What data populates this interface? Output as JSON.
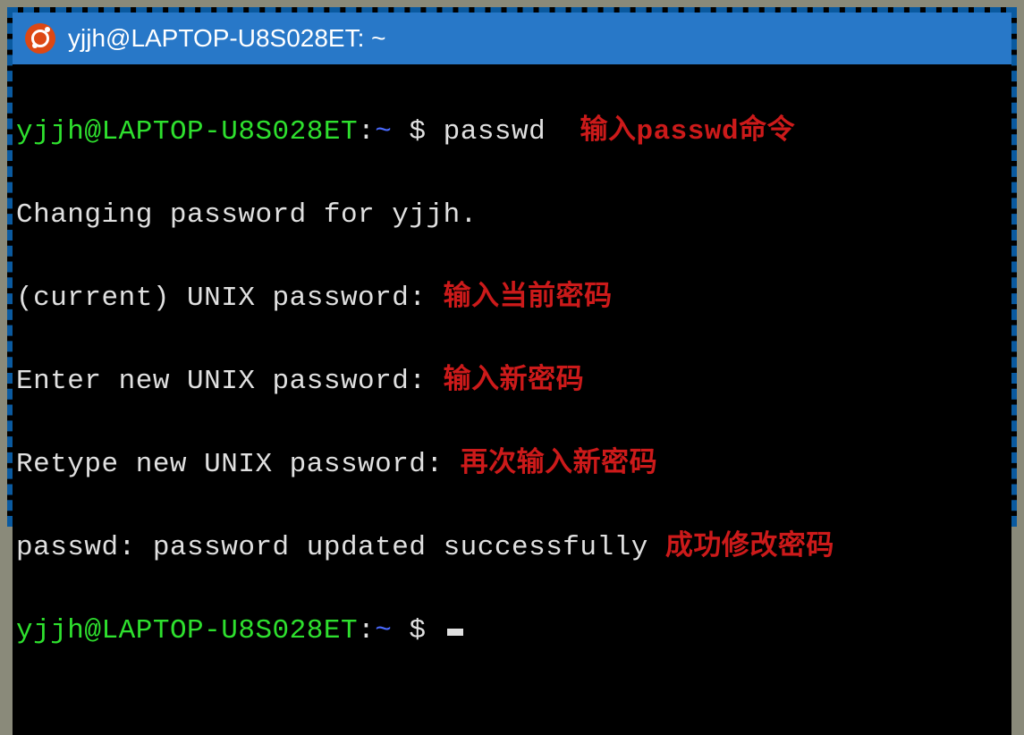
{
  "window": {
    "title": "yjjh@LAPTOP-U8S028ET: ~"
  },
  "prompt": {
    "user": "yjjh",
    "host": "LAPTOP-U8S028ET",
    "path": "~",
    "symbol": "$"
  },
  "lines": {
    "cmd1": "passwd",
    "annot1": "输入passwd命令",
    "out_changing": "Changing password for yjjh.",
    "out_current": "(current) UNIX password:",
    "annot2": "输入当前密码",
    "out_enter": "Enter new UNIX password:",
    "annot3": "输入新密码",
    "out_retype": "Retype new UNIX password:",
    "annot4": "再次输入新密码",
    "out_success": "passwd: password updated successfully",
    "annot5": "成功修改密码"
  }
}
